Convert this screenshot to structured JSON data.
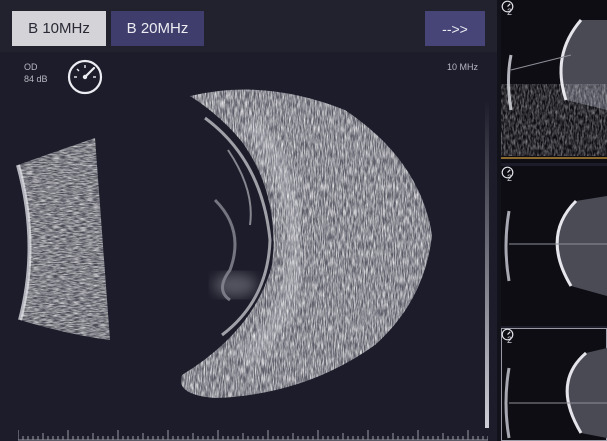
{
  "toolbar": {
    "btn_b10_label": "B 10MHz",
    "btn_b20_label": "B 20MHz",
    "btn_next_label": "-->>"
  },
  "overlay": {
    "eye": "OD",
    "gain": "84 dB",
    "frequency": "10 MHz"
  },
  "thumbnails": [
    {
      "number": "2"
    },
    {
      "number": "2"
    },
    {
      "number": "2"
    }
  ],
  "colors": {
    "active_button": "#d4d4d8",
    "inactive_button": "#3e3d6b",
    "accent_button": "#474578",
    "background": "#1c1c2a"
  }
}
